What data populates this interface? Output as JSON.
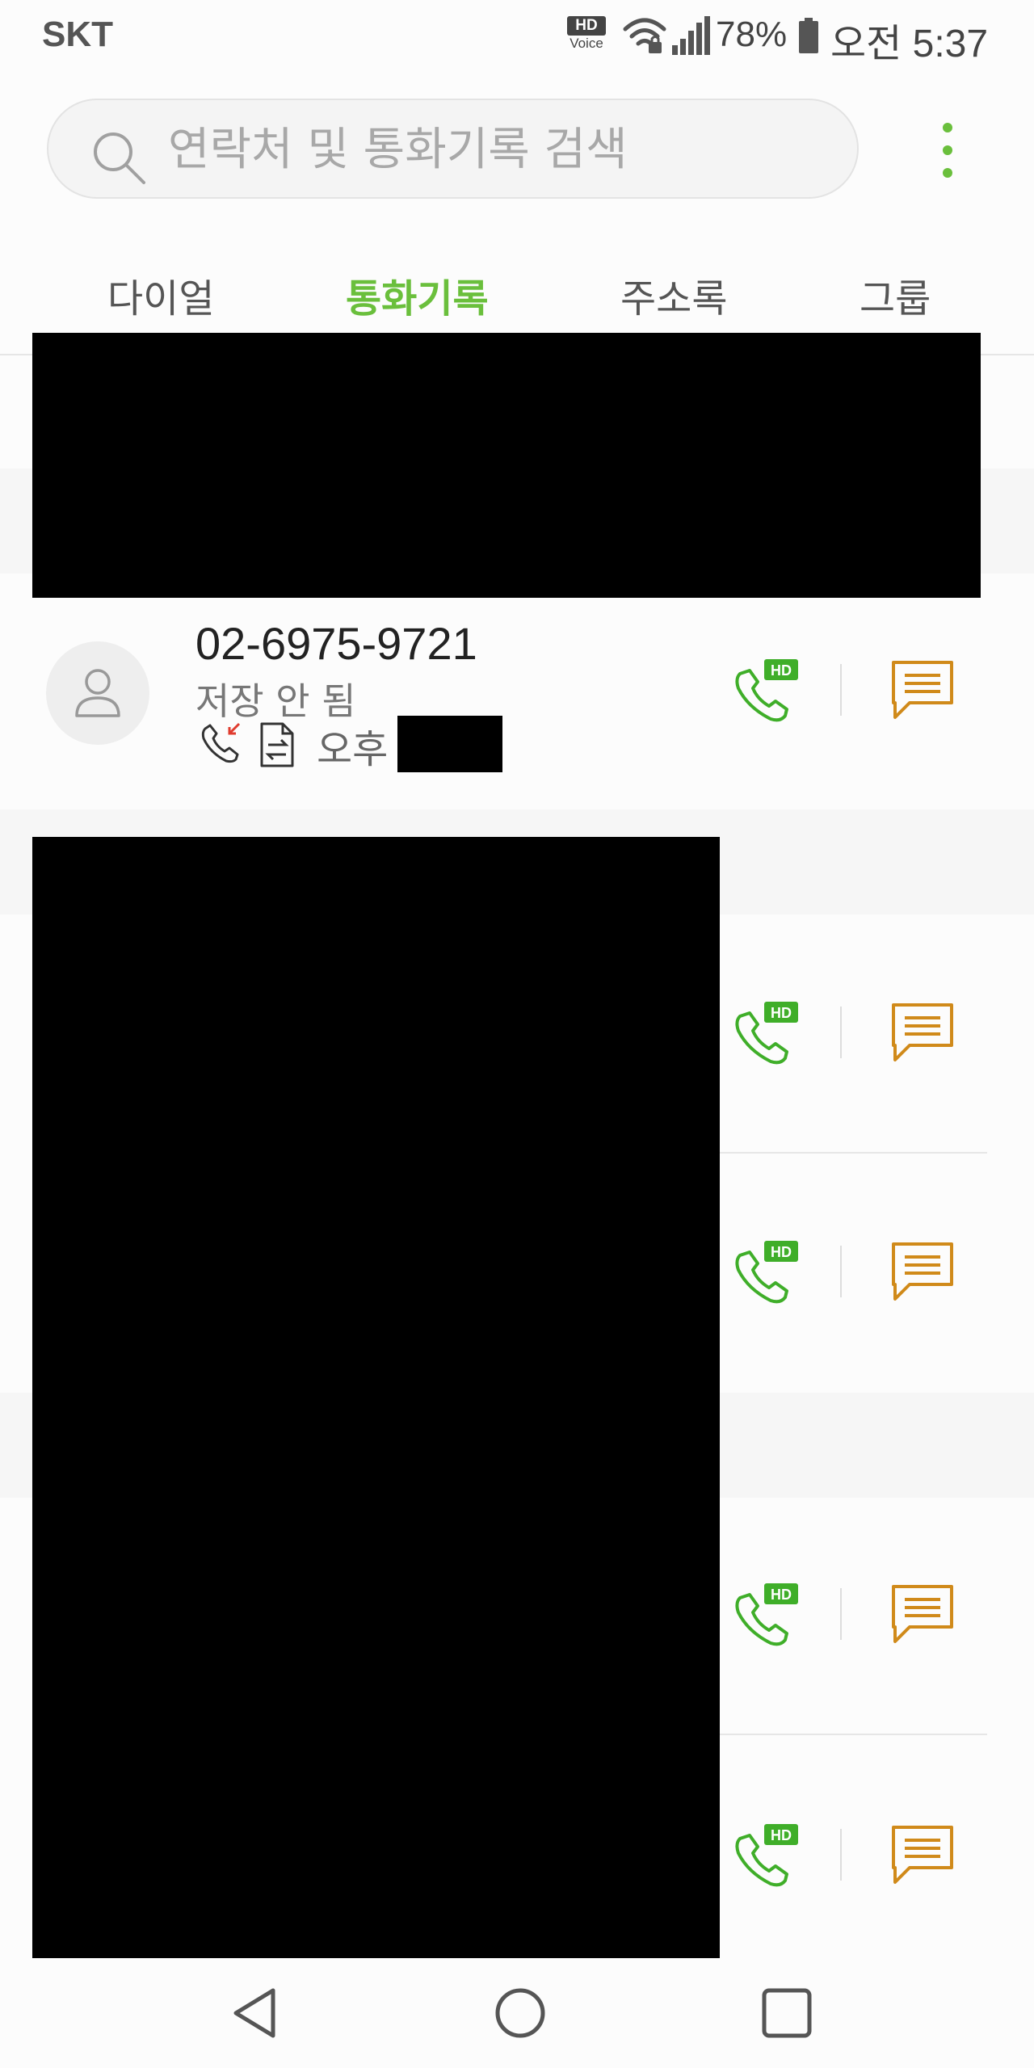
{
  "status_bar": {
    "carrier": "SKT",
    "hd_label": "HD",
    "voice_label": "Voice",
    "battery": "78%",
    "time": "오전 5:37"
  },
  "search": {
    "placeholder": "연락처 및 통화기록 검색",
    "icon": "search-icon"
  },
  "menu": {
    "icon": "more-vertical-icon"
  },
  "tabs": [
    {
      "label": "다이얼",
      "active": false
    },
    {
      "label": "통화기록",
      "active": true
    },
    {
      "label": "주소록",
      "active": false
    },
    {
      "label": "그룹",
      "active": false
    }
  ],
  "call_log": {
    "entry": {
      "number": "02-6975-9721",
      "status": "저장 안 됨",
      "time_prefix": "오후",
      "call_type_icon": "missed-call-icon",
      "extra_icon": "transfer-document-icon"
    },
    "hd_badge": "HD"
  },
  "colors": {
    "accent_green": "#6abf3c",
    "call_green": "#3fae29",
    "message_orange": "#d08a1a"
  },
  "navigation": {
    "back_icon": "back-icon",
    "home_icon": "home-icon",
    "recent_icon": "recent-apps-icon"
  }
}
